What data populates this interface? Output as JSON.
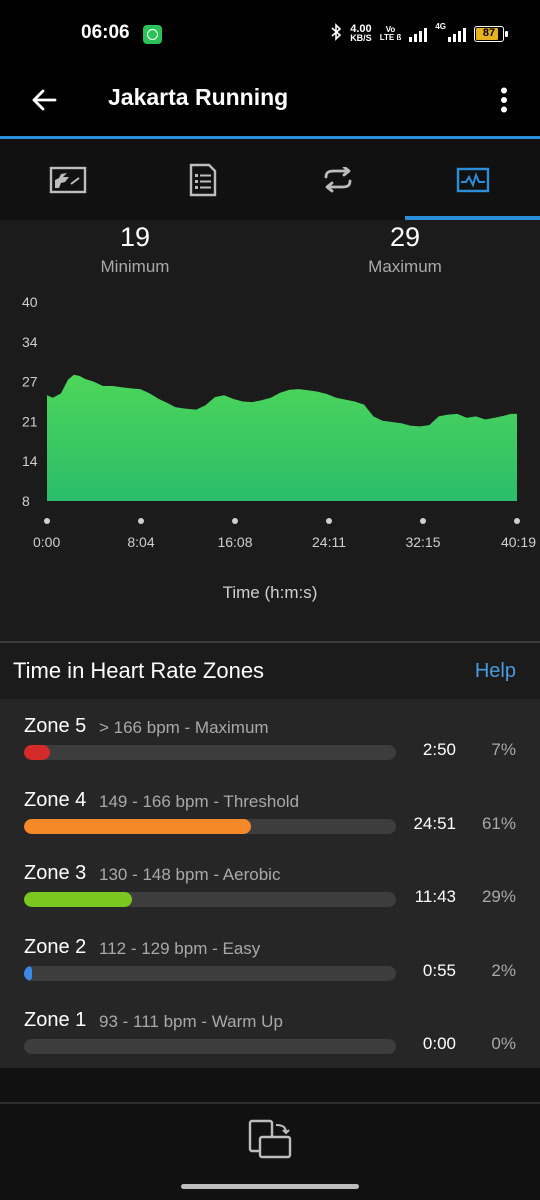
{
  "status_bar": {
    "time": "06:06",
    "speed_value": "4.00",
    "speed_unit": "KB/S",
    "volte_top": "Vo",
    "volte_bottom": "LTE ß",
    "network": "4G",
    "battery": "87",
    "battery_level": 0.87,
    "battery_color": "#e8b21f"
  },
  "app_bar": {
    "title": "Jakarta Running",
    "back_icon": "arrow-left-icon",
    "more_icon": "more-vertical-icon"
  },
  "tabs": [
    {
      "icon": "map-activity-icon",
      "selected": false
    },
    {
      "icon": "document-list-icon",
      "selected": false
    },
    {
      "icon": "laps-loop-icon",
      "selected": false
    },
    {
      "icon": "chart-pulse-icon",
      "selected": true
    }
  ],
  "stats": {
    "minimum_value": "19",
    "minimum_label": "Minimum",
    "maximum_value": "29",
    "maximum_label": "Maximum"
  },
  "chart_data": {
    "type": "area",
    "title": "",
    "xlabel": "Time (h:m:s)",
    "ylabel": "",
    "y_ticks": [
      "40",
      "34",
      "27",
      "21",
      "14",
      "8"
    ],
    "x_ticks": [
      "0:00",
      "8:04",
      "16:08",
      "24:11",
      "32:15",
      "40:19"
    ],
    "ylim": [
      8,
      40
    ],
    "xlim_minutes": [
      0,
      40.32
    ],
    "grid": false,
    "fill_color_top": "#4dd65a",
    "fill_color_bottom": "#2bbd6a",
    "x_minutes": [
      0,
      0.5,
      1.2,
      1.8,
      2.3,
      2.8,
      3.3,
      4.0,
      4.8,
      5.6,
      6.4,
      7.2,
      8.0,
      8.8,
      9.6,
      10.4,
      11.0,
      11.6,
      12.2,
      12.8,
      13.6,
      14.4,
      15.2,
      16.0,
      16.8,
      17.6,
      18.4,
      19.2,
      20.0,
      20.8,
      21.6,
      22.4,
      23.2,
      24.0,
      24.8,
      25.6,
      26.4,
      27.2,
      28.0,
      28.8,
      29.6,
      30.4,
      31.2,
      32.0,
      32.8,
      33.6,
      34.4,
      35.2,
      36.0,
      36.8,
      37.6,
      38.4,
      39.2,
      39.8,
      40.32
    ],
    "y_bpm": [
      25,
      24.6,
      25.3,
      27.5,
      28.3,
      28.1,
      27.6,
      27.2,
      26.5,
      26.5,
      26.3,
      26.1,
      26.0,
      25.3,
      24.4,
      23.7,
      23.1,
      22.9,
      22.8,
      22.7,
      23.4,
      24.7,
      25.0,
      24.4,
      24.0,
      23.9,
      24.2,
      24.6,
      25.4,
      25.9,
      26.0,
      25.8,
      25.6,
      25.2,
      24.6,
      24.3,
      24.0,
      23.5,
      21.6,
      20.9,
      20.7,
      20.5,
      20.1,
      20.0,
      20.2,
      21.6,
      21.9,
      22.0,
      21.4,
      21.6,
      21.1,
      21.4,
      21.7,
      22.0,
      22.0
    ]
  },
  "zones_header": {
    "title": "Time in Heart Rate Zones",
    "help": "Help"
  },
  "zones": [
    {
      "name": "Zone 5",
      "range": "> 166 bpm - Maximum",
      "time": "2:50",
      "percent": "7%",
      "fraction": 0.07,
      "color": "#d42a2a"
    },
    {
      "name": "Zone 4",
      "range": "149 - 166 bpm - Threshold",
      "time": "24:51",
      "percent": "61%",
      "fraction": 0.61,
      "color": "#f5892a"
    },
    {
      "name": "Zone 3",
      "range": "130 - 148 bpm - Aerobic",
      "time": "11:43",
      "percent": "29%",
      "fraction": 0.29,
      "color": "#7ac81f"
    },
    {
      "name": "Zone 2",
      "range": "112 - 129 bpm - Easy",
      "time": "0:55",
      "percent": "2%",
      "fraction": 0.02,
      "color": "#3b8ae8"
    },
    {
      "name": "Zone 1",
      "range": "93 - 111 bpm - Warm Up",
      "time": "0:00",
      "percent": "0%",
      "fraction": 0.0,
      "color": "#888888"
    }
  ],
  "bottom_bar": {
    "icon": "devices-switch-icon"
  }
}
